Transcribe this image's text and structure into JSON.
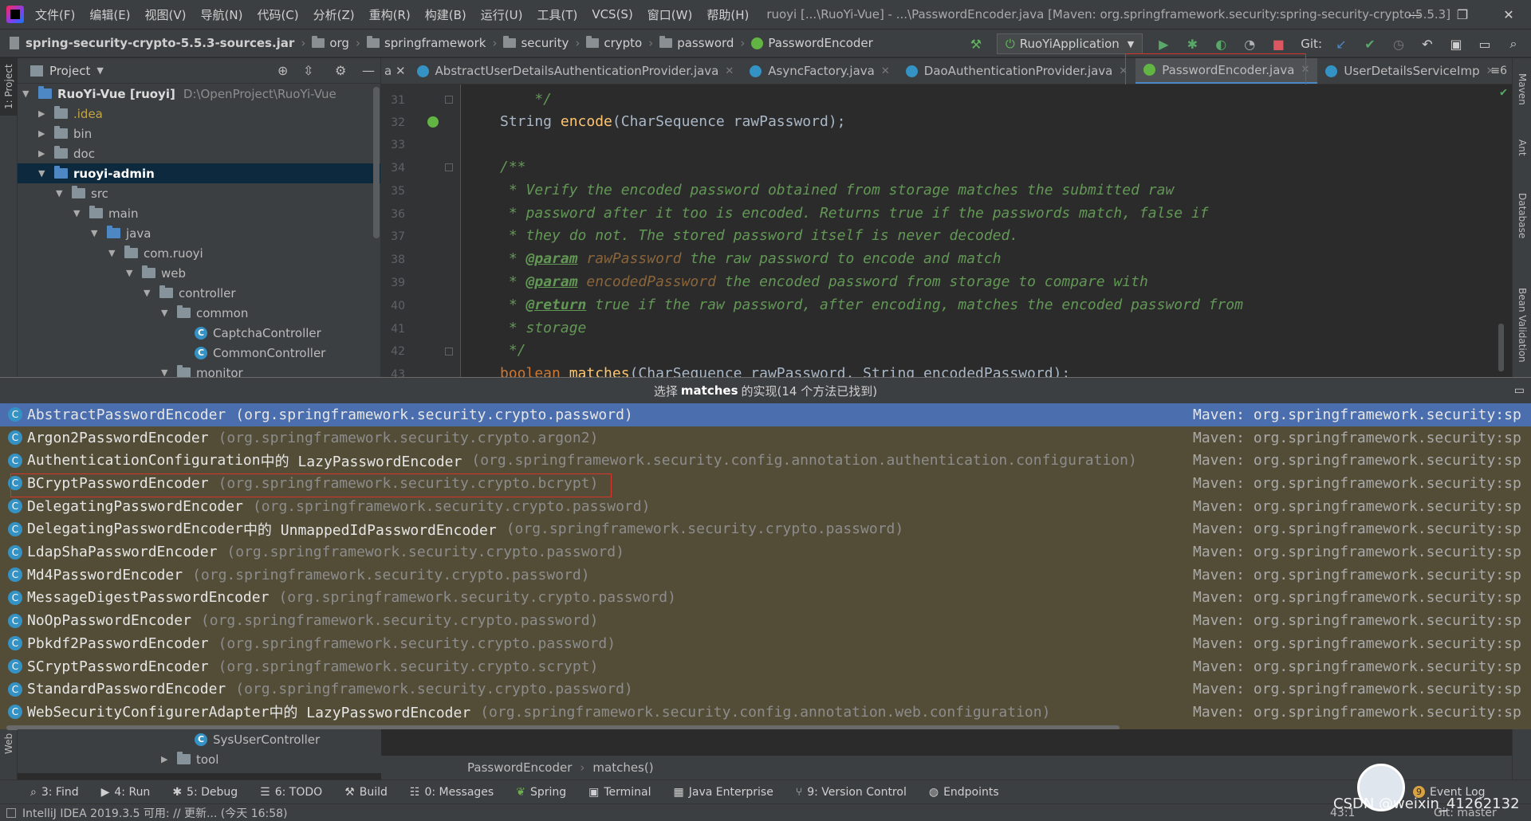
{
  "menubar": {
    "items": [
      "文件(F)",
      "编辑(E)",
      "视图(V)",
      "导航(N)",
      "代码(C)",
      "分析(Z)",
      "重构(R)",
      "构建(B)",
      "运行(U)",
      "工具(T)",
      "VCS(S)",
      "窗口(W)",
      "帮助(H)"
    ],
    "window_title": "ruoyi [...\\RuoYi-Vue] - ...\\PasswordEncoder.java [Maven: org.springframework.security:spring-security-crypto:5.5.3]",
    "minimize": "—",
    "restore": "❐",
    "close": "✕"
  },
  "navbar": {
    "root": "spring-security-crypto-5.5.3-sources.jar",
    "crumbs": [
      "org",
      "springframework",
      "security",
      "crypto",
      "password"
    ],
    "current": "PasswordEncoder",
    "run_config": "RuoYiApplication",
    "git_label": "Git:"
  },
  "left_stripe": {
    "project_tab": "1: Project",
    "web_tab": "Web"
  },
  "right_stripe": {
    "tabs": [
      "Maven",
      "Ant",
      "Database",
      "Bean Validation"
    ]
  },
  "project": {
    "title": "Project",
    "tree": [
      {
        "label": "RuoYi-Vue [ruoyi]",
        "extra": "D:\\OpenProject\\RuoYi-Vue",
        "type": "module"
      },
      {
        "label": ".idea",
        "type": "folder"
      },
      {
        "label": "bin",
        "type": "folder"
      },
      {
        "label": "doc",
        "type": "folder"
      },
      {
        "label": "ruoyi-admin",
        "type": "module"
      },
      {
        "label": "src",
        "type": "folder"
      },
      {
        "label": "main",
        "type": "folder"
      },
      {
        "label": "java",
        "type": "source"
      },
      {
        "label": "com.ruoyi",
        "type": "package"
      },
      {
        "label": "web",
        "type": "package"
      },
      {
        "label": "controller",
        "type": "package"
      },
      {
        "label": "common",
        "type": "package"
      },
      {
        "label": "CaptchaController",
        "type": "class"
      },
      {
        "label": "CommonController",
        "type": "class"
      },
      {
        "label": "monitor",
        "type": "package"
      }
    ],
    "tree_below": [
      {
        "label": "SysUserController",
        "type": "class"
      },
      {
        "label": "tool",
        "type": "package"
      }
    ]
  },
  "editor": {
    "tabs": [
      {
        "label": "AbstractUserDetailsAuthenticationProvider.java",
        "icon": "class"
      },
      {
        "label": "AsyncFactory.java",
        "icon": "class"
      },
      {
        "label": "DaoAuthenticationProvider.java",
        "icon": "class"
      },
      {
        "label": "PasswordEncoder.java",
        "icon": "interface",
        "active": true
      },
      {
        "label": "UserDetailsServiceImp",
        "icon": "class"
      }
    ],
    "tab_overflow": "≡6",
    "line_numbers": [
      "31",
      "32",
      "33",
      "34",
      "35",
      "36",
      "37",
      "38",
      "39",
      "40",
      "41",
      "42",
      "43"
    ],
    "lines": {
      "l31": "    */",
      "l32_type": "String ",
      "l32_fn": "encode",
      "l32_rest": "(CharSequence rawPassword);",
      "l34": "/**",
      "l35": " * Verify the encoded password obtained from storage matches the submitted raw",
      "l36": " * password after it too is encoded. Returns true if the passwords match, false if",
      "l37": " * they do not. The stored password itself is never decoded.",
      "l38_tag": "@param",
      "l38_p": "rawPassword",
      "l38_rest": " the raw password to encode and match",
      "l39_tag": "@param",
      "l39_p": "encodedPassword",
      "l39_rest": " the encoded password from storage to compare with",
      "l40_tag": "@return",
      "l40_rest": " true if the raw password, after encoding, matches the encoded password from",
      "l41": " * storage",
      "l42": " */",
      "l43_kw": "boolean ",
      "l43_fn": "matches",
      "l43_rest": "(CharSequence rawPassword, String encodedPassword);"
    },
    "breadcrumb": [
      "PasswordEncoder",
      "matches()"
    ]
  },
  "popup": {
    "title_prefix": "选择",
    "title_bold": "matches",
    "title_suffix": "的实现(14 个方法已找到)",
    "maven": "Maven: org.springframework.security:sp",
    "rows": [
      {
        "name": "AbstractPasswordEncoder",
        "mid": "",
        "pkg": "(org.springframework.security.crypto.password)",
        "selected": true
      },
      {
        "name": "Argon2PasswordEncoder",
        "mid": "",
        "pkg": "(org.springframework.security.crypto.argon2)"
      },
      {
        "name": "AuthenticationConfiguration",
        "mid": " 中的 LazyPasswordEncoder",
        "pkg": "(org.springframework.security.config.annotation.authentication.configuration)"
      },
      {
        "name": "BCryptPasswordEncoder",
        "mid": "",
        "pkg": "(org.springframework.security.crypto.bcrypt)"
      },
      {
        "name": "DelegatingPasswordEncoder",
        "mid": "",
        "pkg": "(org.springframework.security.crypto.password)"
      },
      {
        "name": "DelegatingPasswordEncoder",
        "mid": " 中的 UnmappedIdPasswordEncoder",
        "pkg": "(org.springframework.security.crypto.password)"
      },
      {
        "name": "LdapShaPasswordEncoder",
        "mid": "",
        "pkg": "(org.springframework.security.crypto.password)"
      },
      {
        "name": "Md4PasswordEncoder",
        "mid": "",
        "pkg": "(org.springframework.security.crypto.password)"
      },
      {
        "name": "MessageDigestPasswordEncoder",
        "mid": "",
        "pkg": "(org.springframework.security.crypto.password)"
      },
      {
        "name": "NoOpPasswordEncoder",
        "mid": "",
        "pkg": "(org.springframework.security.crypto.password)"
      },
      {
        "name": "Pbkdf2PasswordEncoder",
        "mid": "",
        "pkg": "(org.springframework.security.crypto.password)"
      },
      {
        "name": "SCryptPasswordEncoder",
        "mid": "",
        "pkg": "(org.springframework.security.crypto.scrypt)"
      },
      {
        "name": "StandardPasswordEncoder",
        "mid": "",
        "pkg": "(org.springframework.security.crypto.password)"
      },
      {
        "name": "WebSecurityConfigurerAdapter",
        "mid": " 中的 LazyPasswordEncoder",
        "pkg": "(org.springframework.security.config.annotation.web.configuration)"
      }
    ]
  },
  "bottom_tools": [
    {
      "label": "3: Find",
      "icon": "search-icon"
    },
    {
      "label": "4: Run",
      "icon": "play-icon"
    },
    {
      "label": "5: Debug",
      "icon": "bug-icon"
    },
    {
      "label": "6: TODO",
      "icon": "list-icon"
    },
    {
      "label": "Build",
      "icon": "hammer-icon"
    },
    {
      "label": "0: Messages",
      "icon": "message-icon"
    },
    {
      "label": "Spring",
      "icon": "leaf-icon"
    },
    {
      "label": "Terminal",
      "icon": "terminal-icon"
    },
    {
      "label": "Java Enterprise",
      "icon": "enterprise-icon"
    },
    {
      "label": "9: Version Control",
      "icon": "branch-icon"
    },
    {
      "label": "Endpoints",
      "icon": "globe-icon"
    }
  ],
  "event_log": {
    "badge": "9",
    "label": "Event Log"
  },
  "status": {
    "message": "IntelliJ IDEA 2019.3.5 可用: // 更新... (今天 16:58)",
    "position": "43:1",
    "git_branch": "Git: master"
  },
  "watermark": "CSDN @weixin_41262132",
  "colors": {
    "accent": "#4b6eaf",
    "highlight_box": "#d9342b",
    "popup_bg": "#534d37"
  }
}
